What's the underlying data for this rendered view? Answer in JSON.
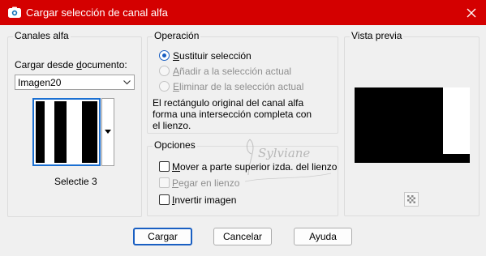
{
  "window": {
    "title": "Cargar selección de canal alfa",
    "title_bar_color": "#d40000",
    "app_icon": "camera-icon",
    "close_icon": "close-icon"
  },
  "channels": {
    "group_title": "Canales alfa",
    "load_from_label_pre": "Cargar desde ",
    "load_from_label_accel": "d",
    "load_from_label_post": "ocumento:",
    "document_value": "Imagen20",
    "channel_name": "Selectie 3"
  },
  "operation": {
    "group_title": "Operación",
    "options": [
      {
        "accel": "S",
        "rest": "ustituir selección",
        "selected": true,
        "enabled": true
      },
      {
        "accel": "A",
        "rest": "ñadir a la selección actual",
        "selected": false,
        "enabled": false
      },
      {
        "accel": "E",
        "rest": "liminar de la selección actual",
        "selected": false,
        "enabled": false
      }
    ],
    "description_lines": [
      "El rectángulo original del canal alfa",
      "forma una intersección completa con",
      "el lienzo."
    ]
  },
  "options": {
    "group_title": "Opciones",
    "checkboxes": [
      {
        "accel": "M",
        "rest": "over a parte superior izda. del lienzo",
        "checked": false,
        "enabled": true
      },
      {
        "accel": "P",
        "rest": "egar en lienzo",
        "checked": false,
        "enabled": false
      },
      {
        "accel": "I",
        "rest": "nvertir imagen",
        "checked": false,
        "enabled": true
      }
    ]
  },
  "preview": {
    "group_title": "Vista previa",
    "toggle_icon": "checkerboard-icon"
  },
  "buttons": {
    "load": "Cargar",
    "cancel": "Cancelar",
    "help": "Ayuda"
  },
  "watermark": {
    "text": "Sylviane"
  },
  "colors": {
    "accent": "#1a5fc2",
    "disabled_text": "#8f8f8f"
  }
}
